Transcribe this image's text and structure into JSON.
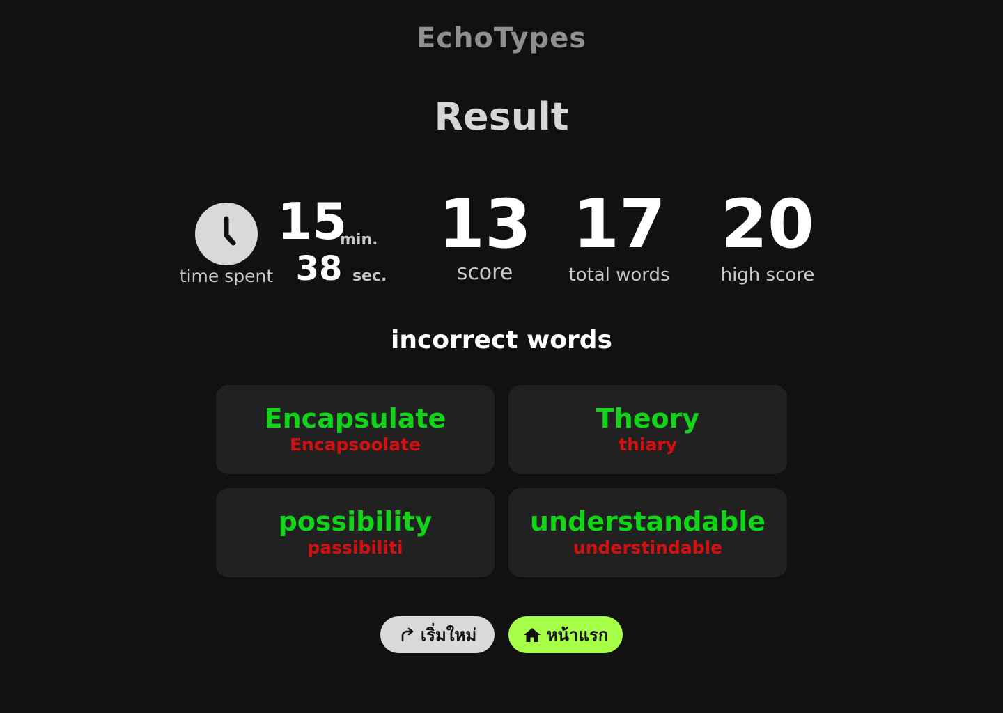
{
  "app": {
    "title": "EchoTypes"
  },
  "result": {
    "heading": "Result"
  },
  "stats": {
    "time": {
      "minutes": "15",
      "min_unit": "min.",
      "seconds": "38",
      "sec_unit": "sec.",
      "label": "time spent",
      "icon": "clock-icon"
    },
    "score": {
      "value": "13",
      "label": "score"
    },
    "total_words": {
      "value": "17",
      "label": "total words"
    },
    "high_score": {
      "value": "20",
      "label": "high score"
    }
  },
  "incorrect": {
    "heading": "incorrect words",
    "words": [
      {
        "correct": "Encapsulate",
        "typed": "Encapsoolate"
      },
      {
        "correct": "Theory",
        "typed": "thiary"
      },
      {
        "correct": "possibility",
        "typed": "passibiliti"
      },
      {
        "correct": "understandable",
        "typed": "understindable"
      }
    ]
  },
  "actions": {
    "restart": {
      "label": "เริ่มใหม่",
      "icon": "redo-arrow-icon"
    },
    "home": {
      "label": "หน้าแรก",
      "icon": "home-icon"
    }
  },
  "colors": {
    "background": "#111111",
    "card": "#212121",
    "correct": "#12d418",
    "typed": "#d40f0f",
    "restart_button": "#d9d9d9",
    "home_button": "#a6ff47"
  }
}
